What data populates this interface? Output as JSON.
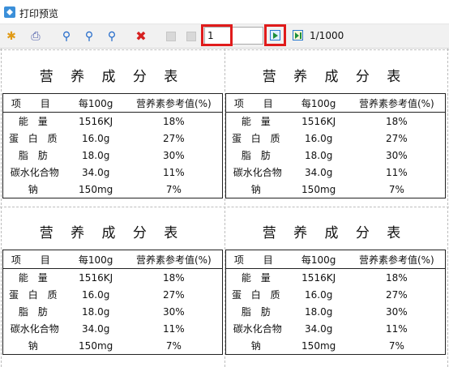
{
  "window": {
    "title": "打印预览"
  },
  "toolbar": {
    "page_input_value": "1",
    "page_count": "1/1000"
  },
  "label": {
    "title": "营 养 成 分 表",
    "headers": [
      "项  目",
      "每100g",
      "营养素参考值(%)"
    ],
    "rows": [
      [
        "能 量",
        "1516KJ",
        "18%"
      ],
      [
        "蛋 白 质",
        "16.0g",
        "27%"
      ],
      [
        "脂 肪",
        "18.0g",
        "30%"
      ],
      [
        "碳水化合物",
        "34.0g",
        "11%"
      ],
      [
        "钠",
        "150mg",
        "7%"
      ]
    ]
  },
  "colors": {
    "highlight": "#e01b1b",
    "accent": "#3b8fd9"
  }
}
